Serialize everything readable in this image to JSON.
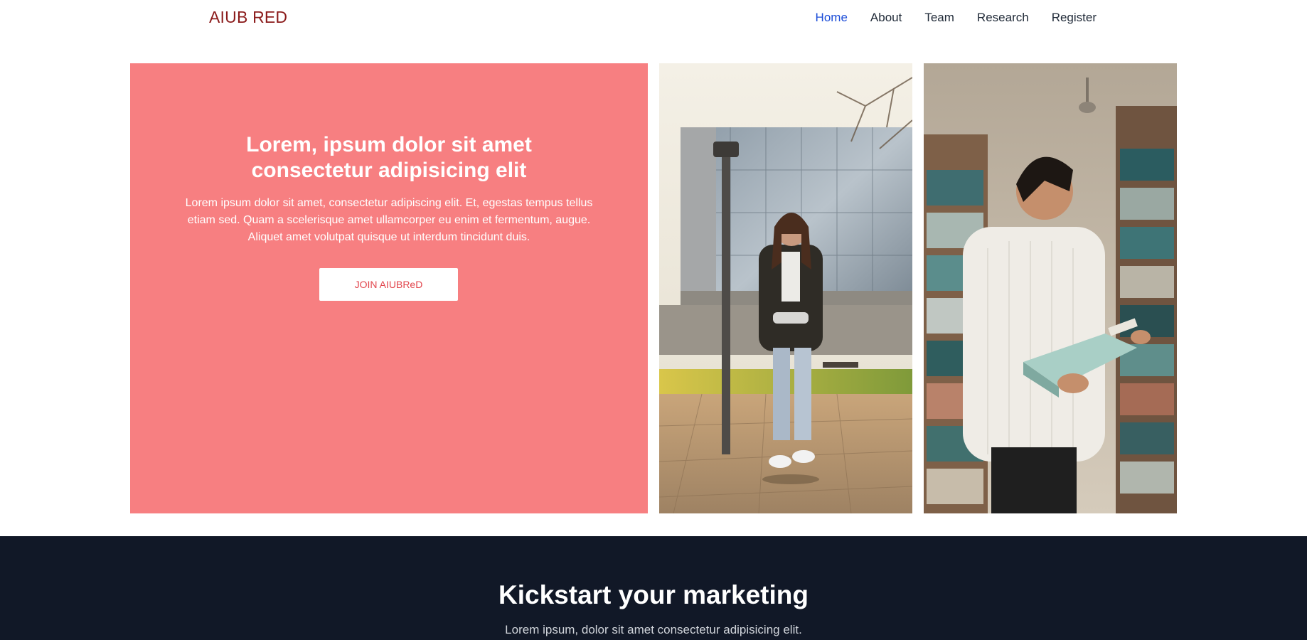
{
  "header": {
    "brand": "AIUB RED",
    "nav": [
      {
        "label": "Home",
        "active": true
      },
      {
        "label": "About",
        "active": false
      },
      {
        "label": "Team",
        "active": false
      },
      {
        "label": "Research",
        "active": false
      },
      {
        "label": "Register",
        "active": false
      }
    ]
  },
  "hero": {
    "title": "Lorem, ipsum dolor sit amet consectetur adipisicing elit",
    "text": "Lorem ipsum dolor sit amet, consectetur adipiscing elit. Et, egestas tempus tellus etiam sed. Quam a scelerisque amet ullamcorper eu enim et fermentum, augue. Aliquet amet volutpat quisque ut interdum tincidunt duis.",
    "button_label": "JOIN AIUBReD",
    "accent_color": "#f77f81"
  },
  "marketing": {
    "title": "Kickstart your marketing",
    "text": "Lorem ipsum, dolor sit amet consectetur adipisicing elit."
  },
  "colors": {
    "brand": "#8b1b1b",
    "nav_active": "#1d4ed8",
    "dark_section": "#111827"
  }
}
